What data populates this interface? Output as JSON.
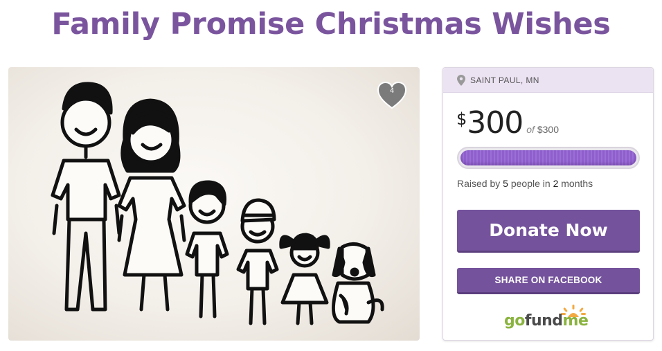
{
  "page": {
    "title": "Family Promise Christmas Wishes"
  },
  "campaign_image": {
    "alt": "Stick figure family illustration",
    "hearts": "4"
  },
  "card": {
    "location": "SAINT PAUL, MN",
    "currency_symbol": "$",
    "raised_amount": "300",
    "goal_prefix": "of",
    "goal_amount": "$300",
    "progress": 1.0,
    "raised_by_prefix": "Raised by",
    "people_count": "5",
    "people_label": "people in",
    "duration": "2",
    "duration_label": "months",
    "donate_label": "Donate Now",
    "share_label": "SHARE ON FACEBOOK",
    "logo": {
      "part1": "go",
      "part2": "fund",
      "part3": "me"
    }
  },
  "colors": {
    "accent": "#74539c",
    "title": "#7a559e",
    "progress": "#8f5fcc",
    "logo_green": "#8ab33f",
    "logo_sun": "#f3a941"
  },
  "icons": [
    "heart-icon",
    "location-pin-icon",
    "gofundme-sun-icon"
  ]
}
